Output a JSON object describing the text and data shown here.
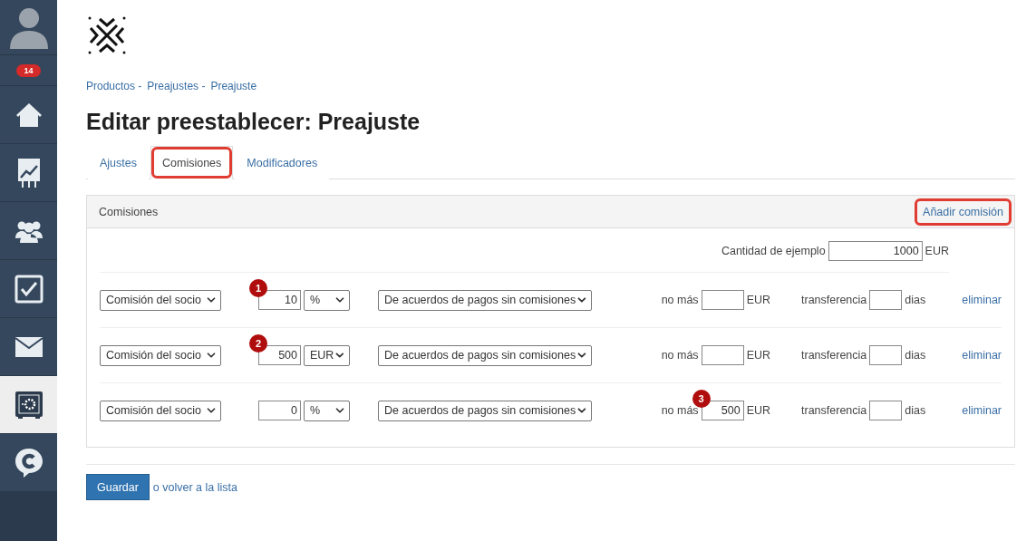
{
  "sidebar": {
    "badge": "14",
    "items": [
      {
        "kind": "home",
        "selected": false
      },
      {
        "kind": "chart",
        "selected": false
      },
      {
        "kind": "people",
        "selected": false
      },
      {
        "kind": "tasks",
        "selected": false
      },
      {
        "kind": "mail",
        "selected": false
      },
      {
        "kind": "safe",
        "selected": true
      },
      {
        "kind": "chat",
        "selected": false
      }
    ]
  },
  "breadcrumbs": [
    "Productos -",
    "Preajustes -",
    "Preajuste"
  ],
  "title": "Editar preestablecer: Preajuste",
  "tabs": [
    {
      "label": "Ajustes",
      "selected": false,
      "highlighted": false
    },
    {
      "label": "Comisiones",
      "selected": true,
      "highlighted": true
    },
    {
      "label": "Modificadores",
      "selected": false,
      "highlighted": false
    }
  ],
  "panel": {
    "title": "Comisiones",
    "add_link": {
      "label": "Añadir comisión",
      "highlighted": true
    },
    "example": {
      "label": "Cantidad de ejemplo",
      "value": "1000",
      "unit": "EUR"
    },
    "rows": [
      {
        "type": "Comisión del socio",
        "amount": "10",
        "callout": "1",
        "unit": "%",
        "source": "De acuerdos de pagos sin comisiones",
        "max_label": "no más",
        "max_value": "",
        "max_callout": "",
        "max_unit": "EUR",
        "transfer_label": "transferencia",
        "transfer_value": "",
        "transfer_unit": "dias",
        "delete": "eliminar"
      },
      {
        "type": "Comisión del socio",
        "amount": "500",
        "callout": "2",
        "unit": "EUR",
        "source": "De acuerdos de pagos sin comisiones",
        "max_label": "no más",
        "max_value": "",
        "max_callout": "",
        "max_unit": "EUR",
        "transfer_label": "transferencia",
        "transfer_value": "",
        "transfer_unit": "dias",
        "delete": "eliminar"
      },
      {
        "type": "Comisión del socio",
        "amount": "0",
        "callout": "",
        "unit": "%",
        "source": "De acuerdos de pagos sin comisiones",
        "max_label": "no más",
        "max_value": "500",
        "max_callout": "3",
        "max_unit": "EUR",
        "transfer_label": "transferencia",
        "transfer_value": "",
        "transfer_unit": "dias",
        "delete": "eliminar"
      }
    ]
  },
  "footer": {
    "save": "Guardar",
    "back": "o volver a la lista"
  }
}
